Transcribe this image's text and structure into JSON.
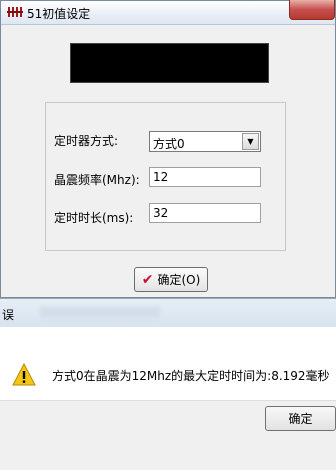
{
  "window": {
    "title": "51初值设定"
  },
  "form": {
    "timer_mode_label": "定时器方式:",
    "timer_mode_value": "方式0",
    "crystal_label": "晶震频率(Mhz):",
    "crystal_value": "12",
    "duration_label": "定时时长(ms):",
    "duration_value": "32"
  },
  "ok_button": {
    "label": "确定(O)"
  },
  "message_box": {
    "title": "误",
    "text": "方式0在晶震为12Mhz的最大定时时间为:8.192毫秒",
    "ok_label": "确定"
  }
}
